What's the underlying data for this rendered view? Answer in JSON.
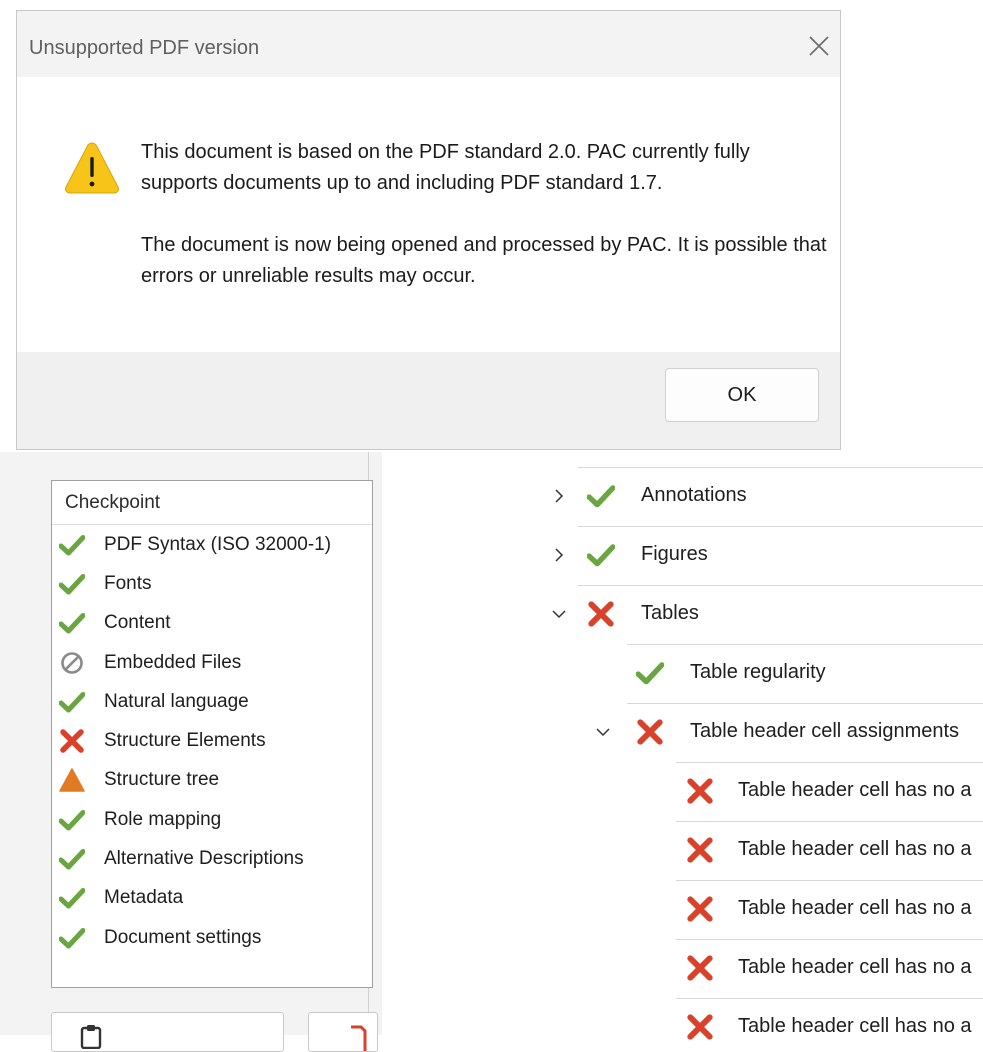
{
  "dialog": {
    "title": "Unsupported PDF version",
    "message_line1": "This document is based on the PDF standard 2.0. PAC currently fully supports documents up to and including PDF standard 1.7.",
    "message_line2": "The document is now being opened and processed by PAC. It is possible that errors or unreliable results may occur.",
    "ok_label": "OK"
  },
  "checkpoints": {
    "header": "Checkpoint",
    "items": [
      {
        "label": "PDF Syntax (ISO 32000-1)",
        "status": "pass",
        "icon": "check-icon"
      },
      {
        "label": "Fonts",
        "status": "pass",
        "icon": "check-icon"
      },
      {
        "label": "Content",
        "status": "pass",
        "icon": "check-icon"
      },
      {
        "label": "Embedded Files",
        "status": "not-applicable",
        "icon": "prohibited-icon"
      },
      {
        "label": "Natural language",
        "status": "pass",
        "icon": "check-icon"
      },
      {
        "label": "Structure Elements",
        "status": "fail",
        "icon": "cross-icon"
      },
      {
        "label": "Structure tree",
        "status": "warning",
        "icon": "warning-triangle-icon"
      },
      {
        "label": "Role mapping",
        "status": "pass",
        "icon": "check-icon"
      },
      {
        "label": "Alternative Descriptions",
        "status": "pass",
        "icon": "check-icon"
      },
      {
        "label": "Metadata",
        "status": "pass",
        "icon": "check-icon"
      },
      {
        "label": "Document settings",
        "status": "pass",
        "icon": "check-icon"
      }
    ]
  },
  "tree": {
    "rows": [
      {
        "label": "Annotations",
        "status": "pass",
        "expanded": false
      },
      {
        "label": "Figures",
        "status": "pass",
        "expanded": false
      },
      {
        "label": "Tables",
        "status": "fail",
        "expanded": true
      },
      {
        "label": "Table regularity",
        "status": "pass",
        "expanded": null
      },
      {
        "label": "Table header cell assignments",
        "status": "fail",
        "expanded": true
      },
      {
        "label": "Table header cell has no a",
        "status": "fail",
        "expanded": null
      },
      {
        "label": "Table header cell has no a",
        "status": "fail",
        "expanded": null
      },
      {
        "label": "Table header cell has no a",
        "status": "fail",
        "expanded": null
      },
      {
        "label": "Table header cell has no a",
        "status": "fail",
        "expanded": null
      },
      {
        "label": "Table header cell has no a",
        "status": "fail",
        "expanded": null
      }
    ]
  },
  "colors": {
    "pass": "#6aa541",
    "fail": "#d9412b",
    "warning": "#e07b24",
    "na": "#8a8a8a",
    "warning_dialog": "#f7c51a"
  }
}
